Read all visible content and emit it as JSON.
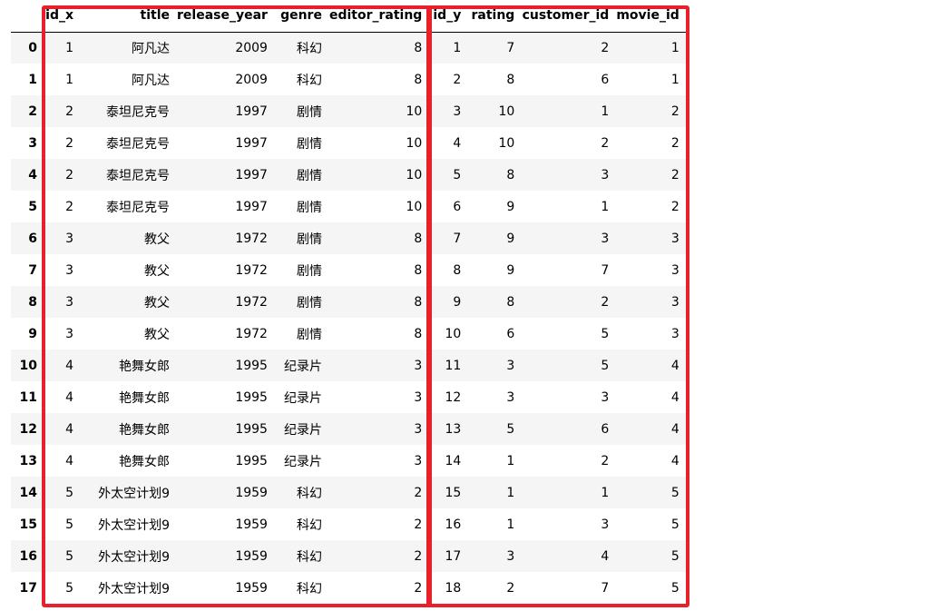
{
  "table": {
    "columns": [
      "id_x",
      "title",
      "release_year",
      "genre",
      "editor_rating",
      "id_y",
      "rating",
      "customer_id",
      "movie_id"
    ],
    "rows": [
      {
        "index": "0",
        "cells": [
          "1",
          "阿凡达",
          "2009",
          "科幻",
          "8",
          "1",
          "7",
          "2",
          "1"
        ]
      },
      {
        "index": "1",
        "cells": [
          "1",
          "阿凡达",
          "2009",
          "科幻",
          "8",
          "2",
          "8",
          "6",
          "1"
        ]
      },
      {
        "index": "2",
        "cells": [
          "2",
          "泰坦尼克号",
          "1997",
          "剧情",
          "10",
          "3",
          "10",
          "1",
          "2"
        ]
      },
      {
        "index": "3",
        "cells": [
          "2",
          "泰坦尼克号",
          "1997",
          "剧情",
          "10",
          "4",
          "10",
          "2",
          "2"
        ]
      },
      {
        "index": "4",
        "cells": [
          "2",
          "泰坦尼克号",
          "1997",
          "剧情",
          "10",
          "5",
          "8",
          "3",
          "2"
        ]
      },
      {
        "index": "5",
        "cells": [
          "2",
          "泰坦尼克号",
          "1997",
          "剧情",
          "10",
          "6",
          "9",
          "1",
          "2"
        ]
      },
      {
        "index": "6",
        "cells": [
          "3",
          "教父",
          "1972",
          "剧情",
          "8",
          "7",
          "9",
          "3",
          "3"
        ]
      },
      {
        "index": "7",
        "cells": [
          "3",
          "教父",
          "1972",
          "剧情",
          "8",
          "8",
          "9",
          "7",
          "3"
        ]
      },
      {
        "index": "8",
        "cells": [
          "3",
          "教父",
          "1972",
          "剧情",
          "8",
          "9",
          "8",
          "2",
          "3"
        ]
      },
      {
        "index": "9",
        "cells": [
          "3",
          "教父",
          "1972",
          "剧情",
          "8",
          "10",
          "6",
          "5",
          "3"
        ]
      },
      {
        "index": "10",
        "cells": [
          "4",
          "艳舞女郎",
          "1995",
          "纪录片",
          "3",
          "11",
          "3",
          "5",
          "4"
        ]
      },
      {
        "index": "11",
        "cells": [
          "4",
          "艳舞女郎",
          "1995",
          "纪录片",
          "3",
          "12",
          "3",
          "3",
          "4"
        ]
      },
      {
        "index": "12",
        "cells": [
          "4",
          "艳舞女郎",
          "1995",
          "纪录片",
          "3",
          "13",
          "5",
          "6",
          "4"
        ]
      },
      {
        "index": "13",
        "cells": [
          "4",
          "艳舞女郎",
          "1995",
          "纪录片",
          "3",
          "14",
          "1",
          "2",
          "4"
        ]
      },
      {
        "index": "14",
        "cells": [
          "5",
          "外太空计划9",
          "1959",
          "科幻",
          "2",
          "15",
          "1",
          "1",
          "5"
        ]
      },
      {
        "index": "15",
        "cells": [
          "5",
          "外太空计划9",
          "1959",
          "科幻",
          "2",
          "16",
          "1",
          "3",
          "5"
        ]
      },
      {
        "index": "16",
        "cells": [
          "5",
          "外太空计划9",
          "1959",
          "科幻",
          "2",
          "17",
          "3",
          "4",
          "5"
        ]
      },
      {
        "index": "17",
        "cells": [
          "5",
          "外太空计划9",
          "1959",
          "科幻",
          "2",
          "18",
          "2",
          "7",
          "5"
        ]
      }
    ]
  },
  "annotations": {
    "highlight_color": "#e8202a",
    "boxes": [
      {
        "label": "movies-columns-box",
        "covers": [
          "id_x",
          "title",
          "release_year",
          "genre",
          "editor_rating"
        ]
      },
      {
        "label": "ratings-columns-box",
        "covers": [
          "id_y",
          "rating",
          "customer_id",
          "movie_id"
        ]
      }
    ]
  }
}
